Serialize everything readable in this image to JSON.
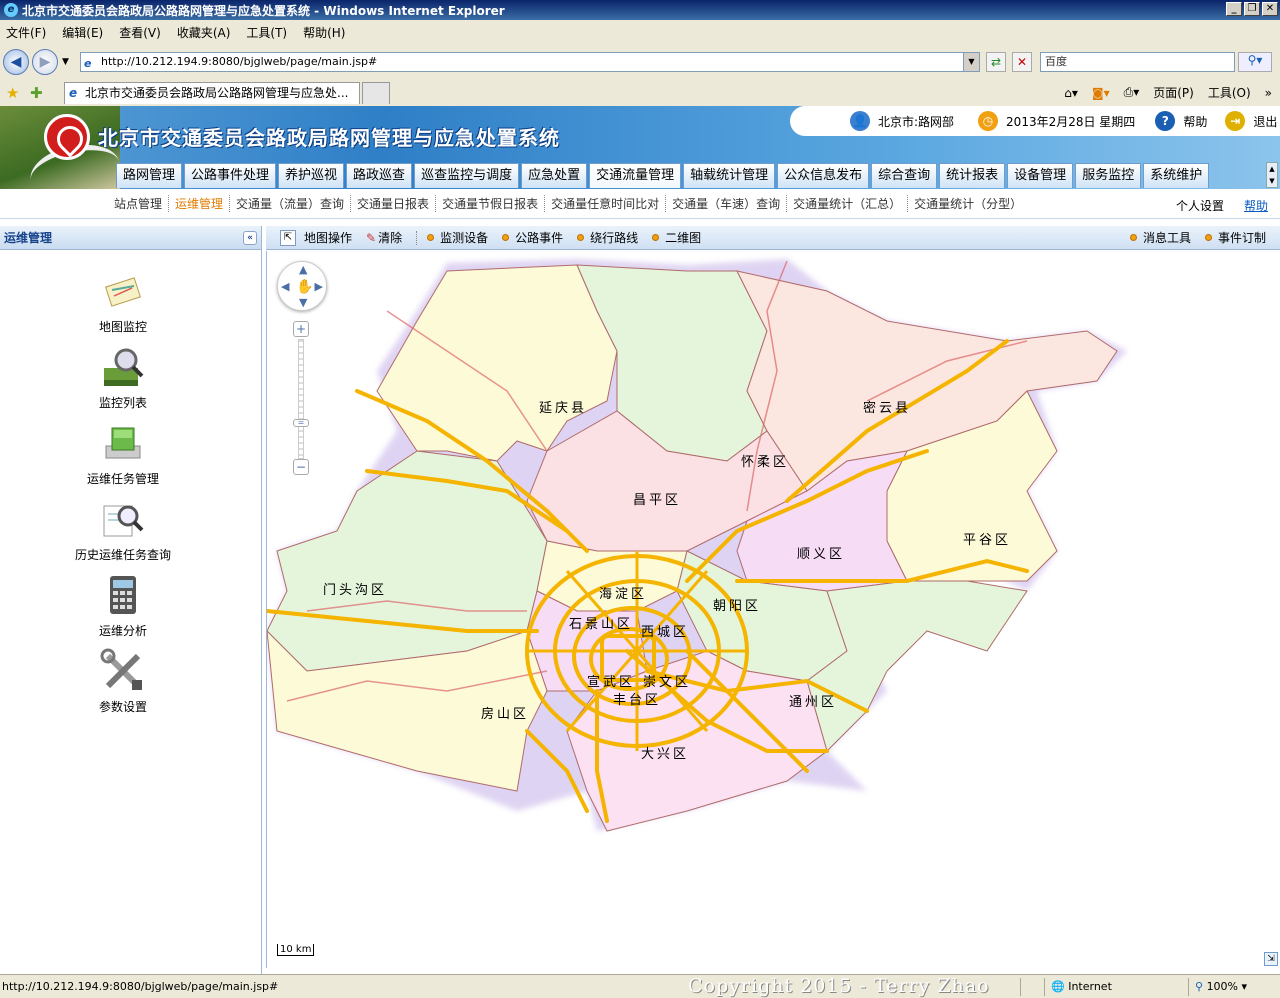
{
  "browser": {
    "window_title": "北京市交通委员会路政局公路路网管理与应急处置系统 - Windows Internet Explorer",
    "menu": [
      "文件(F)",
      "编辑(E)",
      "查看(V)",
      "收藏夹(A)",
      "工具(T)",
      "帮助(H)"
    ],
    "address": "http://10.212.194.9:8080/bjglweb/page/main.jsp#",
    "search_placeholder": "百度",
    "tab_title": "北京市交通委员会路政局公路路网管理与应急处...",
    "commands": [
      "页面(P)",
      "工具(O)"
    ]
  },
  "app": {
    "title": "北京市交通委员会路政局路网管理与应急处置系统",
    "user": "北京市:路网部",
    "date": "2013年2月28日  星期四",
    "help": "帮助",
    "logout": "退出",
    "main_nav": [
      "路网管理",
      "公路事件处理",
      "养护巡视",
      "路政巡查",
      "巡查监控与调度",
      "应急处置",
      "交通流量管理",
      "轴载统计管理",
      "公众信息发布",
      "综合查询",
      "统计报表",
      "设备管理",
      "服务监控",
      "系统维护"
    ],
    "main_nav_active": 6,
    "sub_nav": [
      "站点管理",
      "运维管理",
      "交通量（流量）查询",
      "交通量日报表",
      "交通量节假日报表",
      "交通量任意时间比对",
      "交通量（车速）查询",
      "交通量统计（汇总）",
      "交通量统计（分型）"
    ],
    "sub_nav_active": 1,
    "sub_right": [
      "个人设置",
      "帮助"
    ]
  },
  "left_panel": {
    "title": "运维管理",
    "items": [
      {
        "label": "地图监控",
        "icon": "map-monitor-icon"
      },
      {
        "label": "监控列表",
        "icon": "monitor-list-icon"
      },
      {
        "label": "运维任务管理",
        "icon": "task-manage-icon"
      },
      {
        "label": "历史运维任务查询",
        "icon": "history-query-icon"
      },
      {
        "label": "运维分析",
        "icon": "calculator-icon"
      },
      {
        "label": "参数设置",
        "icon": "tools-icon"
      }
    ]
  },
  "map_toolbar": {
    "left": [
      "地图操作",
      "清除",
      "监测设备",
      "公路事件",
      "绕行路线",
      "二维图"
    ],
    "right": [
      "消息工具",
      "事件订制"
    ]
  },
  "map": {
    "districts": [
      "延庆县",
      "密云县",
      "怀柔区",
      "昌平区",
      "平谷区",
      "顺义区",
      "门头沟区",
      "海淀区",
      "朝阳区",
      "石景山区",
      "西城区",
      "宣武区",
      "崇文区",
      "丰台区",
      "通州区",
      "房山区",
      "大兴区"
    ],
    "scale": "10 km"
  },
  "status": {
    "url": "http://10.212.194.9:8080/bjglweb/page/main.jsp#",
    "copyright": "Copyright 2015 - Terry Zhao",
    "zone": "Internet",
    "zoom": "100%"
  },
  "colors": {
    "accent": "#2f7fc7",
    "active_sub": "#e07b00",
    "road": "#f4b400"
  }
}
